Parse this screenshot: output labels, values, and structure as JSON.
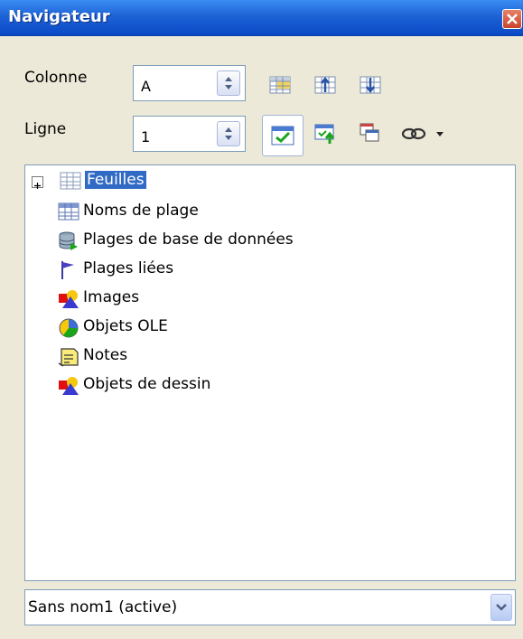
{
  "window": {
    "title": "Navigateur",
    "close_icon": "close-icon"
  },
  "column": {
    "label": "Colonne",
    "value": "A"
  },
  "row": {
    "label": "Ligne",
    "value": "1"
  },
  "toolbar": {
    "icons": [
      "data-range-icon",
      "start-icon",
      "end-icon",
      "contents-icon",
      "drag-mode-icon",
      "scenarios-icon",
      "link-icon",
      "dropdown-arrow-icon"
    ]
  },
  "tree": {
    "items": [
      {
        "label": "Feuilles",
        "icon": "sheets-icon",
        "selected": true,
        "expandable": true
      },
      {
        "label": "Noms de plage",
        "icon": "range-names-icon"
      },
      {
        "label": "Plages de base de données",
        "icon": "database-range-icon"
      },
      {
        "label": "Plages liées",
        "icon": "linked-range-flag-icon"
      },
      {
        "label": "Images",
        "icon": "images-icon"
      },
      {
        "label": "Objets OLE",
        "icon": "ole-objects-icon"
      },
      {
        "label": "Notes",
        "icon": "notes-icon"
      },
      {
        "label": "Objets de dessin",
        "icon": "drawing-objects-icon"
      }
    ]
  },
  "document_select": {
    "value": "Sans nom1 (active)"
  }
}
